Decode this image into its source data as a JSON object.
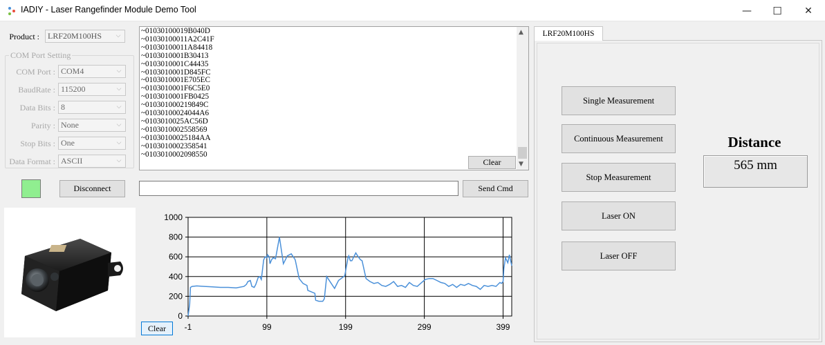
{
  "window": {
    "title": "IADIY - Laser Rangefinder Module Demo Tool",
    "minimize": "—",
    "maximize": "☐",
    "close": "✕"
  },
  "product": {
    "label": "Product :",
    "value": "LRF20M100HS"
  },
  "com_port_setting": {
    "title": "COM Port Setting",
    "fields": [
      {
        "label": "COM Port :",
        "value": "COM4"
      },
      {
        "label": "BaudRate :",
        "value": "115200"
      },
      {
        "label": "Data Bits :",
        "value": "8"
      },
      {
        "label": "Parity :",
        "value": "None"
      },
      {
        "label": "Stop Bits :",
        "value": "One"
      },
      {
        "label": "Data Format :",
        "value": "ASCII"
      }
    ]
  },
  "connection": {
    "status_color": "#90ee90",
    "disconnect_label": "Disconnect"
  },
  "log": {
    "lines": [
      "~01030100019B040D",
      "~01030100011A2C41F",
      "~01030100011A84418",
      "~0103010001B30413",
      "~0103010001C44435",
      "~0103010001D845FC",
      "~0103010001E705EC",
      "~0103010001F6C5E0",
      "~0103010001FB0425",
      "~010301000219849C",
      "~01030100024044A6",
      "~0103010025AC56D",
      "~0103010002558569",
      "~01030100025184AA",
      "~0103010002358541",
      "~0103010002098550"
    ],
    "clear_label": "Clear"
  },
  "command": {
    "value": "",
    "send_label": "Send Cmd"
  },
  "chart": {
    "clear_label": "Clear"
  },
  "chart_data": {
    "type": "line",
    "xlim": [
      -1,
      410
    ],
    "ylim": [
      0,
      1000
    ],
    "x_ticks": [
      "-1",
      "99",
      "199",
      "299",
      "399"
    ],
    "y_ticks": [
      "0",
      "200",
      "400",
      "600",
      "800",
      "1000"
    ],
    "grid": true,
    "line_color": "#4a90d9",
    "series": [
      {
        "x": [
          -1,
          1,
          2,
          4,
          10,
          20,
          30,
          40,
          50,
          60,
          70,
          73,
          75,
          78,
          80,
          83,
          85,
          88,
          90,
          92,
          95,
          97,
          99,
          100,
          102,
          103,
          105,
          107,
          110,
          115,
          120,
          125,
          130,
          135,
          140,
          145,
          150,
          151,
          160,
          161,
          165,
          170,
          172,
          175,
          180,
          185,
          190,
          195,
          198,
          200,
          202,
          203,
          205,
          207,
          210,
          212,
          215,
          218,
          220,
          225,
          230,
          235,
          240,
          245,
          250,
          255,
          260,
          265,
          270,
          275,
          280,
          285,
          290,
          300,
          305,
          310,
          315,
          320,
          325,
          330,
          335,
          340,
          345,
          350,
          355,
          360,
          365,
          370,
          375,
          380,
          385,
          390,
          395,
          397,
          399,
          400,
          402,
          405,
          407,
          410
        ],
        "y": [
          0,
          120,
          290,
          300,
          305,
          300,
          295,
          290,
          290,
          285,
          300,
          320,
          350,
          360,
          300,
          290,
          320,
          390,
          400,
          370,
          570,
          600,
          590,
          620,
          600,
          530,
          570,
          590,
          580,
          800,
          530,
          610,
          630,
          570,
          380,
          330,
          310,
          260,
          230,
          160,
          150,
          150,
          175,
          400,
          340,
          280,
          360,
          390,
          410,
          500,
          590,
          610,
          560,
          560,
          610,
          640,
          600,
          570,
          560,
          380,
          350,
          330,
          340,
          310,
          300,
          320,
          350,
          300,
          310,
          290,
          340,
          310,
          300,
          370,
          380,
          380,
          360,
          340,
          330,
          300,
          320,
          290,
          320,
          310,
          330,
          310,
          300,
          270,
          310,
          300,
          310,
          300,
          340,
          330,
          350,
          480,
          590,
          540,
          620,
          510
        ]
      }
    ]
  },
  "tab": {
    "label": "LRF20M100HS"
  },
  "actions": {
    "single": "Single Measurement",
    "continuous": "Continuous Measurement",
    "stop": "Stop Measurement",
    "laser_on": "Laser ON",
    "laser_off": "Laser OFF"
  },
  "distance": {
    "title": "Distance",
    "value": "565 mm"
  }
}
